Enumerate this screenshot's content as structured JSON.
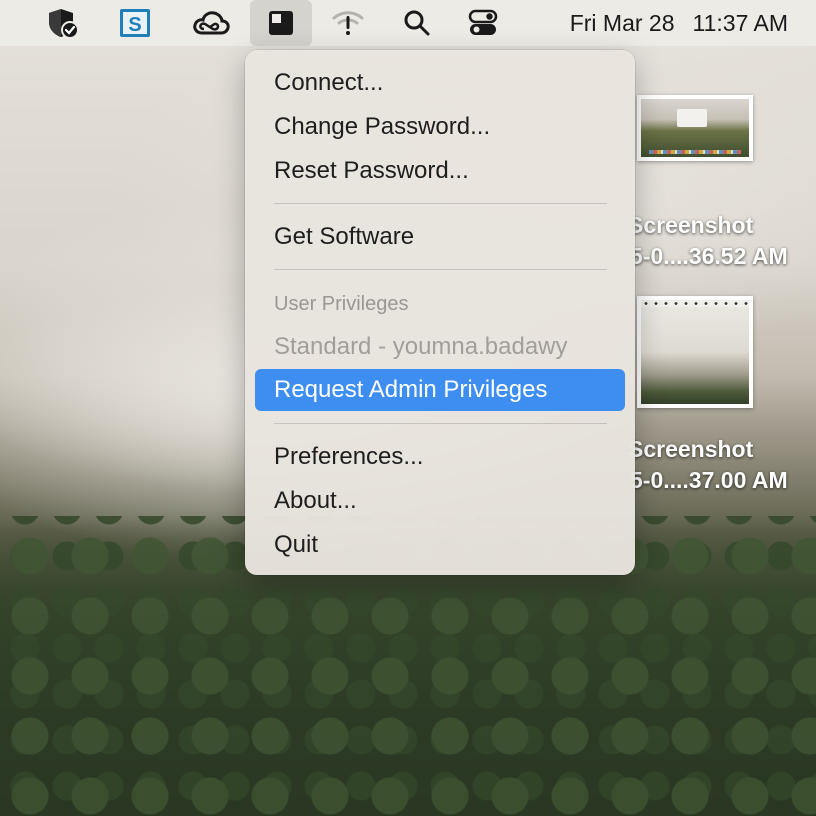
{
  "menubar": {
    "icons": [
      {
        "name": "shield-check-icon"
      },
      {
        "name": "self-service-icon",
        "letter": "S"
      },
      {
        "name": "creative-cloud-icon"
      },
      {
        "name": "privileges-icon"
      },
      {
        "name": "wifi-off-icon"
      },
      {
        "name": "search-icon"
      },
      {
        "name": "control-center-icon"
      }
    ],
    "date": "Fri Mar 28",
    "time": "11:37 AM"
  },
  "menu": {
    "connect": "Connect...",
    "change_password": "Change Password...",
    "reset_password": "Reset Password...",
    "get_software": "Get Software",
    "section_header": "User Privileges",
    "current_account": "Standard - youmna.badawy",
    "request_admin": "Request Admin Privileges",
    "preferences": "Preferences...",
    "about": "About...",
    "quit": "Quit"
  },
  "desktop": {
    "file1": {
      "line1": "Screenshot",
      "line2": "5-0....36.52 AM"
    },
    "file2": {
      "line1": "Screenshot",
      "line2": "5-0....37.00 AM"
    }
  },
  "colors": {
    "selection": "#3d8ef0",
    "menu_background": "#e8e4de",
    "disabled_text": "#a19e99"
  }
}
